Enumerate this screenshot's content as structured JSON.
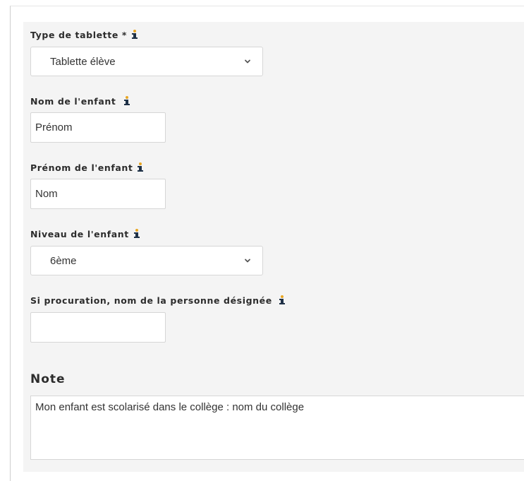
{
  "form": {
    "tablet_type": {
      "label": "Type de tablette *",
      "selected": "Tablette élève"
    },
    "child_last_name": {
      "label": "Nom de l'enfant",
      "placeholder": "Prénom"
    },
    "child_first_name": {
      "label": "Prénom de l'enfant",
      "placeholder": "Nom"
    },
    "child_level": {
      "label": "Niveau de l'enfant",
      "selected": "6ème"
    },
    "proxy_name": {
      "label": "Si procuration, nom de la personne désignée",
      "value": ""
    },
    "note": {
      "title": "Note",
      "value": "Mon enfant est scolarisé dans le collège : nom du collège"
    }
  },
  "icons": {
    "info": "info-icon",
    "dropdown": "chevron-down-icon"
  },
  "colors": {
    "panel_background": "#f4f4f4",
    "info_icon_dot": "#e8a623",
    "info_icon_body": "#1f3147",
    "input_border": "#d6d6d6",
    "text": "#333333"
  }
}
